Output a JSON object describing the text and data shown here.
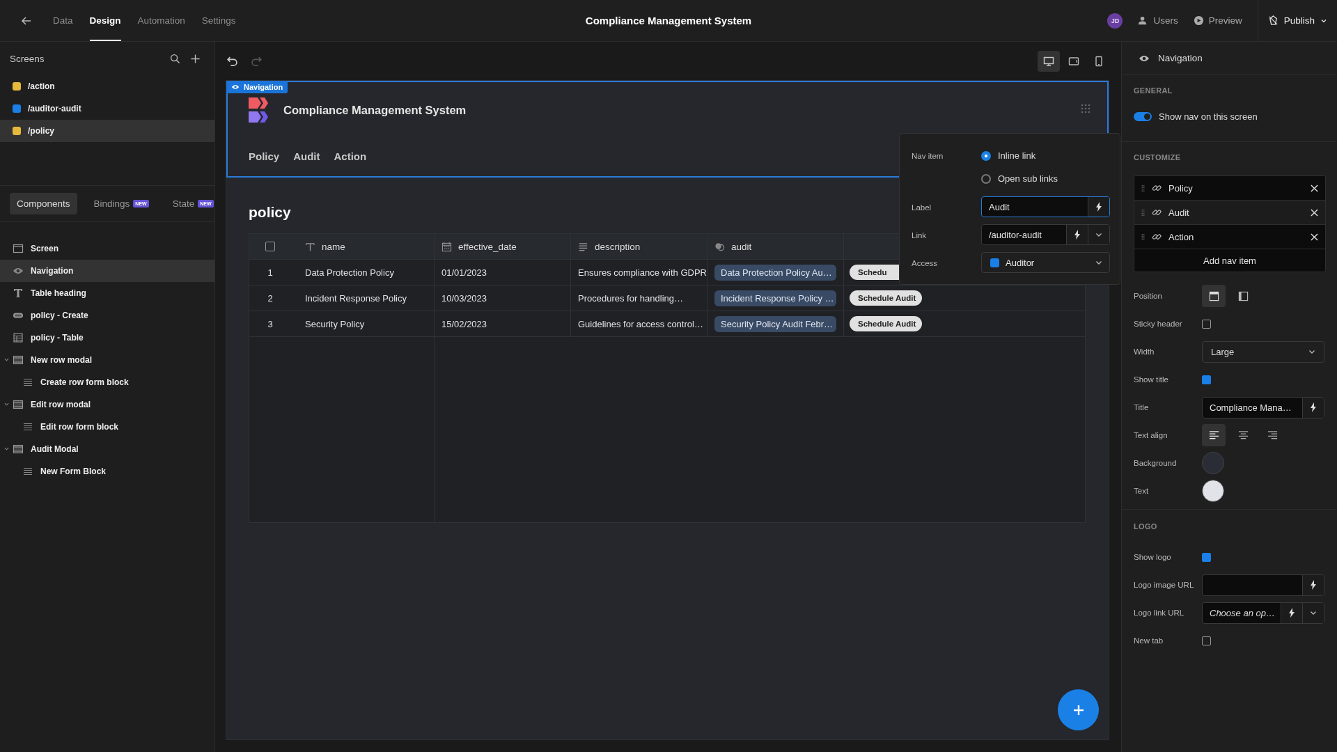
{
  "top_bar": {
    "tabs": [
      {
        "label": "Data",
        "selected": false
      },
      {
        "label": "Design",
        "selected": true
      },
      {
        "label": "Automation",
        "selected": false
      },
      {
        "label": "Settings",
        "selected": false
      }
    ],
    "title": "Compliance Management System",
    "avatar": "JD",
    "actions": [
      {
        "kind": "users",
        "label": "Users"
      },
      {
        "kind": "preview",
        "label": "Preview"
      },
      {
        "kind": "publish",
        "label": "Publish"
      }
    ]
  },
  "screens": {
    "title": "Screens",
    "items": [
      {
        "route": "/action",
        "color": "#e6b93c",
        "selected": false
      },
      {
        "route": "/auditor-audit",
        "color": "#1a7fe6",
        "selected": false
      },
      {
        "route": "/policy",
        "color": "#e6b93c",
        "selected": true
      }
    ]
  },
  "panel_tabs": [
    {
      "label": "Components",
      "selected": true
    },
    {
      "label": "Bindings",
      "badge": "NEW",
      "selected": false
    },
    {
      "label": "State",
      "badge": "NEW",
      "selected": false
    }
  ],
  "components": [
    {
      "kind": "screen",
      "label": "Screen",
      "selected": false
    },
    {
      "kind": "navigation",
      "label": "Navigation",
      "selected": true
    },
    {
      "kind": "text",
      "label": "Table heading",
      "selected": false
    },
    {
      "kind": "button",
      "label": "policy - Create",
      "selected": false
    },
    {
      "kind": "table",
      "label": "policy - Table",
      "selected": false
    },
    {
      "kind": "modal",
      "label": "New row modal",
      "selected": false,
      "expanded": true,
      "children": [
        {
          "kind": "form",
          "label": "Create row form block",
          "selected": false
        }
      ]
    },
    {
      "kind": "modal",
      "label": "Edit row modal",
      "selected": false,
      "expanded": true,
      "children": [
        {
          "kind": "form",
          "label": "Edit row form block",
          "selected": false
        }
      ]
    },
    {
      "kind": "modal",
      "label": "Audit Modal",
      "selected": false,
      "expanded": true,
      "children": [
        {
          "kind": "form",
          "label": "New Form Block",
          "selected": false
        }
      ]
    }
  ],
  "history": {
    "redo_disabled": true
  },
  "devices": [
    {
      "kind": "desktop",
      "selected": true
    },
    {
      "kind": "tablet",
      "selected": false
    },
    {
      "kind": "mobile",
      "selected": false
    }
  ],
  "nav_preview": {
    "tag": "Navigation",
    "title": "Compliance Management System",
    "links": [
      "Policy",
      "Audit",
      "Action"
    ]
  },
  "heading": "policy",
  "table": {
    "select_all_checked": false,
    "columns": [
      {
        "kind": "text",
        "label": "name"
      },
      {
        "kind": "date",
        "label": "effective_date"
      },
      {
        "kind": "longform",
        "label": "description"
      },
      {
        "kind": "relationship",
        "label": "audit"
      }
    ],
    "rows": [
      {
        "index": "1",
        "cells": [
          "Data Protection Policy",
          "01/01/2023",
          "Ensures compliance with GDPR"
        ],
        "audit": "Data Protection Policy Au…",
        "button": "Schedu"
      },
      {
        "index": "2",
        "cells": [
          "Incident Response Policy",
          "10/03/2023",
          "Procedures for handling…"
        ],
        "audit": "Incident Response Policy …",
        "button": "Schedule Audit"
      },
      {
        "index": "3",
        "cells": [
          "Security Policy",
          "15/02/2023",
          "Guidelines for access control…"
        ],
        "audit": "Security Policy Audit Febr…",
        "button": "Schedule Audit"
      }
    ]
  },
  "popover": {
    "nav_item_label": "Nav item",
    "options": [
      {
        "label": "Inline link",
        "selected": true
      },
      {
        "label": "Open sub links",
        "selected": false
      }
    ],
    "fields": [
      {
        "kind": "binding",
        "label": "Label",
        "value": "Audit",
        "focused": true
      },
      {
        "kind": "binding_select",
        "label": "Link",
        "value": "/auditor-audit",
        "focused": false
      },
      {
        "kind": "role",
        "label": "Access",
        "value": "Auditor",
        "color": "#1a7fe6",
        "focused": false
      }
    ]
  },
  "settings": {
    "title": "Navigation",
    "general": {
      "heading": "GENERAL",
      "toggle": {
        "label": "Show nav on this screen",
        "on": true
      }
    },
    "customize": {
      "heading": "CUSTOMIZE",
      "nav_items": [
        {
          "label": "Policy",
          "selected": false
        },
        {
          "label": "Audit",
          "selected": true
        },
        {
          "label": "Action",
          "selected": false
        }
      ],
      "add_label": "Add nav item",
      "rows": [
        {
          "kind": "position",
          "label": "Position",
          "options": [
            {
              "kind": "top",
              "selected": true
            },
            {
              "kind": "left",
              "selected": false
            }
          ]
        },
        {
          "kind": "checkbox",
          "label": "Sticky header",
          "checked": false
        },
        {
          "kind": "select",
          "label": "Width",
          "value": "Large"
        },
        {
          "kind": "checkbox",
          "label": "Show title",
          "checked": true
        },
        {
          "kind": "binding",
          "label": "Title",
          "value": "Compliance Mana…"
        },
        {
          "kind": "align",
          "label": "Text align",
          "options": [
            {
              "kind": "left",
              "selected": true
            },
            {
              "kind": "center",
              "selected": false
            },
            {
              "kind": "right",
              "selected": false
            }
          ]
        },
        {
          "kind": "color",
          "label": "Background",
          "color": "#2a2d35"
        },
        {
          "kind": "color",
          "label": "Text",
          "color": "#e1e3e8"
        }
      ]
    },
    "logo": {
      "heading": "LOGO",
      "rows": [
        {
          "kind": "checkbox",
          "label": "Show logo",
          "checked": true
        },
        {
          "kind": "binding",
          "label": "Logo image URL"
        },
        {
          "kind": "binding_select",
          "label": "Logo link URL",
          "placeholder": "Choose an op…"
        },
        {
          "kind": "checkbox",
          "label": "New tab",
          "checked": false
        }
      ]
    }
  }
}
